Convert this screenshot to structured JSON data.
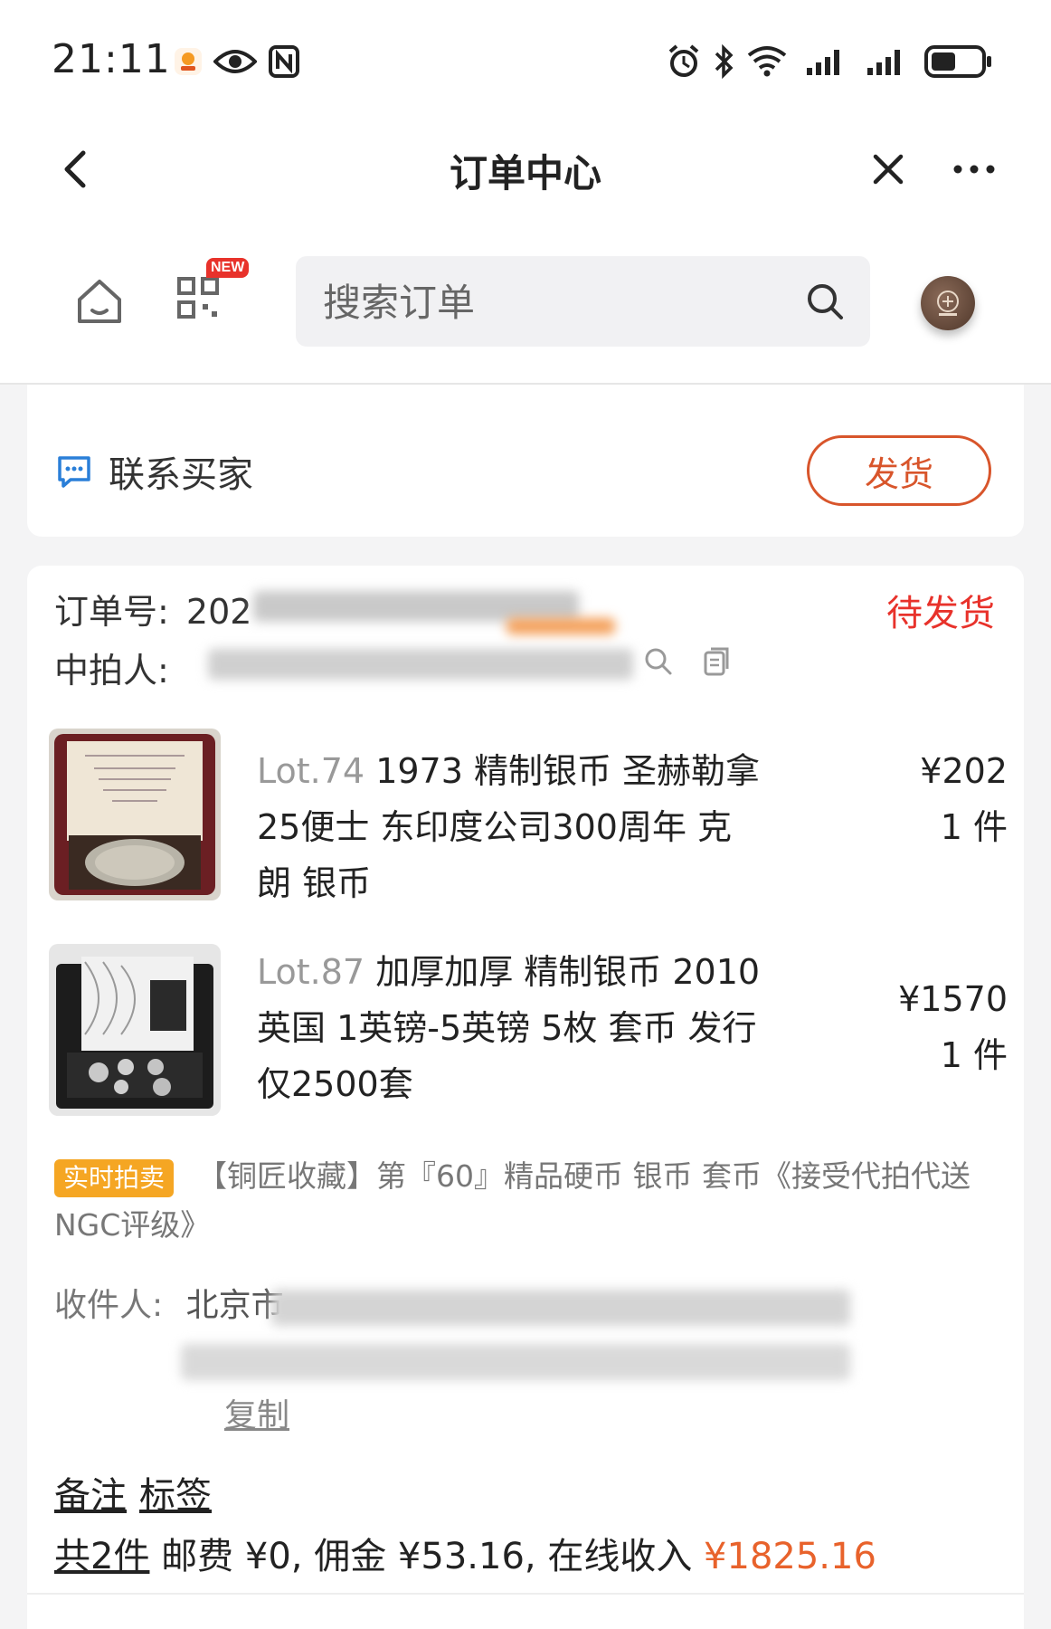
{
  "status_bar": {
    "time": "21:11",
    "left_icons": [
      "app-notification-icon",
      "eye-icon",
      "nfc-icon"
    ],
    "right_icons": [
      "alarm-icon",
      "bluetooth-icon",
      "wifi-icon",
      "signal-icon",
      "signal-icon",
      "battery-icon"
    ]
  },
  "header": {
    "title": "订单中心",
    "back_icon": "chevron-left-icon",
    "close_icon": "close-icon",
    "more_icon": "more-icon"
  },
  "toolbar": {
    "home_icon": "home-icon",
    "grid_icon": "grid-icon",
    "new_badge": "NEW",
    "search_placeholder": "搜索订单",
    "search_icon": "search-icon"
  },
  "top_card": {
    "contact_label": "联系买家",
    "ship_button": "发货"
  },
  "order": {
    "order_no_label": "订单号:",
    "order_no_visible": "202",
    "winner_label": "中拍人:",
    "status": "待发货",
    "items": [
      {
        "lot_no": "Lot.74",
        "title": "1973 精制银币 圣赫勒拿 25便士 东印度公司300周年 克朗 银币",
        "price": "¥202",
        "qty": "1 件"
      },
      {
        "lot_no": "Lot.87",
        "title": "加厚加厚 精制银币 2010 英国 1英镑-5英镑 5枚 套币 发行仅2500套",
        "price": "¥1570",
        "qty": "1 件"
      }
    ],
    "auction_tag": "实时拍卖",
    "auction_name": "【铜匠收藏】第『60』精品硬币 银币 套币《接受代拍代送NGC评级》",
    "receiver_label": "收件人:",
    "receiver_visible": "北京市",
    "copy_label": "复制",
    "remark_label": "备注",
    "label_label": "标签",
    "summary": {
      "count": "共2件",
      "shipping": "邮费 ¥0,",
      "commission": "佣金 ¥53.16,",
      "income_label": "在线收入",
      "income_value": "¥1825.16"
    }
  },
  "colors": {
    "accent": "#e8322b",
    "button_border": "#d8552b",
    "income": "#e8622b",
    "tag_bg": "#f5a623"
  }
}
